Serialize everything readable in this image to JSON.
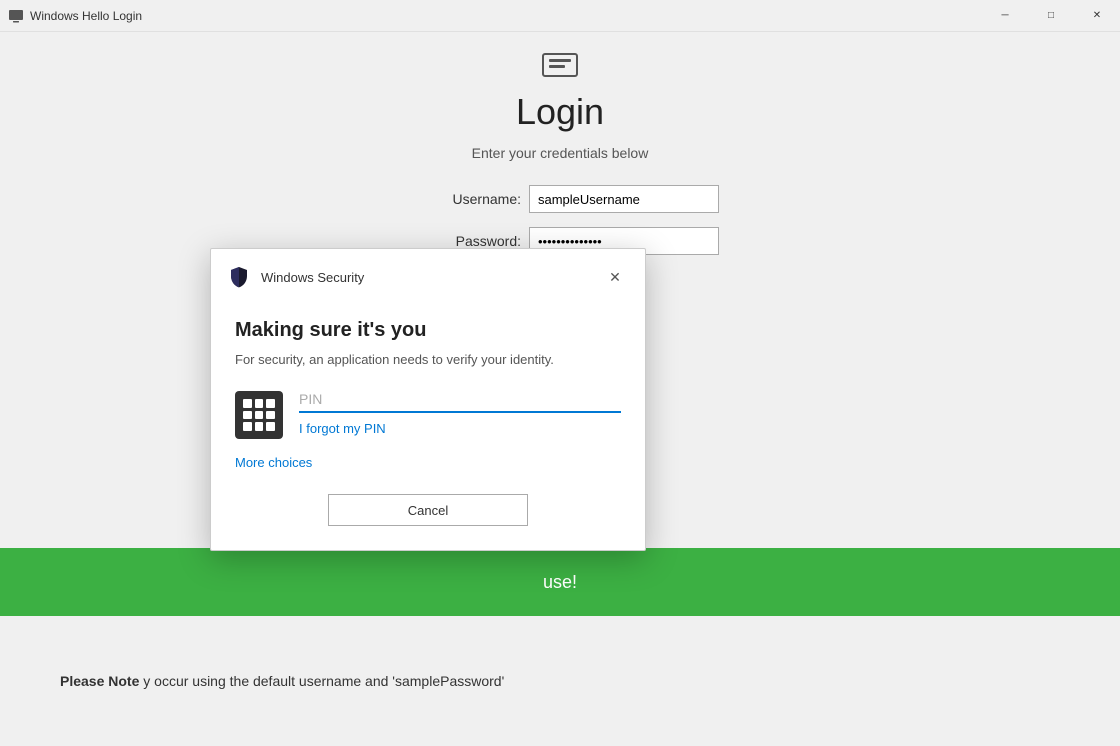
{
  "titleBar": {
    "title": "Windows Hello Login",
    "iconLabel": "app-icon",
    "controls": {
      "minimize": "─",
      "maximize": "□",
      "close": "✕"
    }
  },
  "mainApp": {
    "loginIconAlt": "login-card-icon",
    "title": "Login",
    "subtitle": "Enter your credentials below",
    "form": {
      "usernameLabel": "Username:",
      "usernameValue": "sampleUsername",
      "passwordLabel": "Password:",
      "passwordValue": "••••••••••••••"
    },
    "greenBanner": {
      "text": "use!"
    },
    "note": {
      "prefix": "Please Note",
      "text": "y occur using the default username and 'samplePassword'"
    }
  },
  "securityDialog": {
    "headerTitle": "Windows Security",
    "closeLabel": "✕",
    "mainTitle": "Making sure it's you",
    "description": "For security, an application needs to verify your identity.",
    "pinPlaceholder": "PIN",
    "forgotPinLabel": "I forgot my PIN",
    "moreChoicesLabel": "More choices",
    "cancelLabel": "Cancel"
  }
}
